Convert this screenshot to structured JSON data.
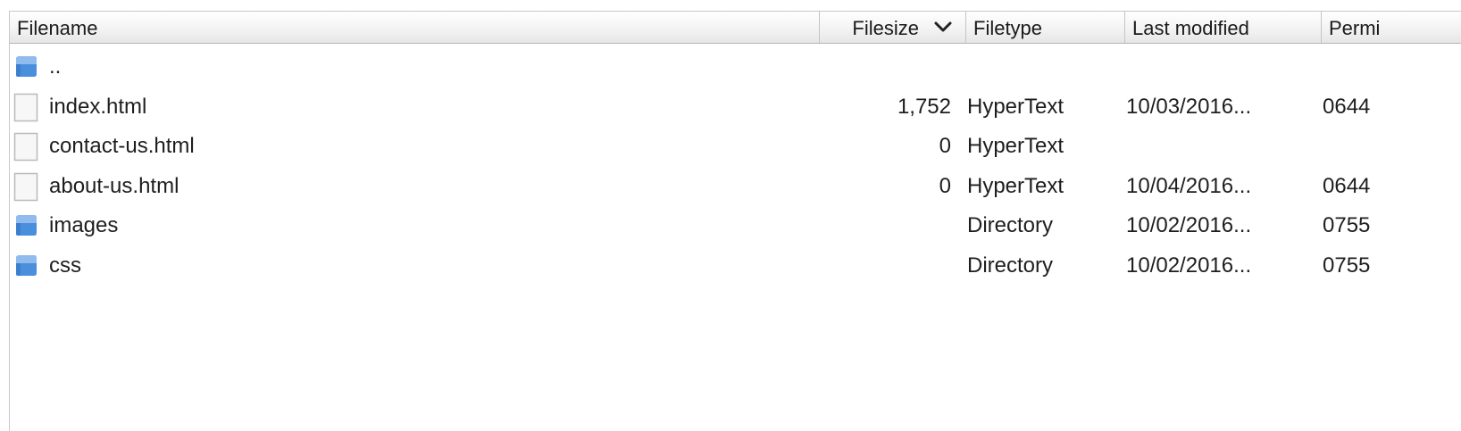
{
  "columns": {
    "filename": "Filename",
    "filesize": "Filesize",
    "filetype": "Filetype",
    "last_modified": "Last modified",
    "permissions": "Permi"
  },
  "sort": {
    "column": "Filesize",
    "icon": "chevron-down-icon"
  },
  "colors": {
    "folder": "#4a8fdb",
    "file_border": "#b9b9b9",
    "header_border": "#b5b5b5"
  },
  "files": [
    {
      "kind": "folder",
      "icon": "folder-icon",
      "name": "..",
      "size": "",
      "type": "",
      "modified": "",
      "perms": ""
    },
    {
      "kind": "file",
      "icon": "file-icon",
      "name": "index.html",
      "size": "1,752",
      "type": "HyperText",
      "modified": "10/03/2016...",
      "perms": "0644"
    },
    {
      "kind": "file",
      "icon": "file-icon",
      "name": "contact-us.html",
      "size": "0",
      "type": "HyperText",
      "modified": "",
      "perms": ""
    },
    {
      "kind": "file",
      "icon": "file-icon",
      "name": "about-us.html",
      "size": "0",
      "type": "HyperText",
      "modified": "10/04/2016...",
      "perms": "0644"
    },
    {
      "kind": "folder",
      "icon": "folder-icon",
      "name": "images",
      "size": "",
      "type": "Directory",
      "modified": "10/02/2016...",
      "perms": "0755"
    },
    {
      "kind": "folder",
      "icon": "folder-icon",
      "name": "css",
      "size": "",
      "type": "Directory",
      "modified": "10/02/2016...",
      "perms": "0755"
    }
  ]
}
